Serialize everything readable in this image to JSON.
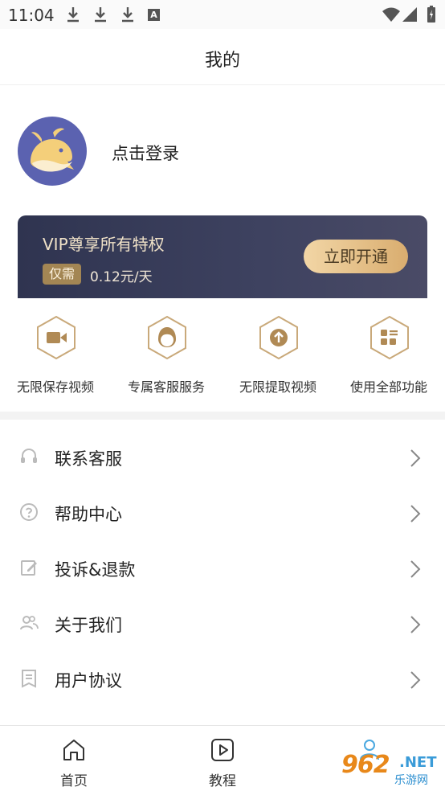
{
  "status_bar": {
    "time": "11:04"
  },
  "header": {
    "title": "我的"
  },
  "profile": {
    "login_text": "点击登录"
  },
  "vip": {
    "title": "VIP尊享所有特权",
    "badge": "仅需",
    "price": "0.12元/天",
    "button_label": "立即开通"
  },
  "features": [
    {
      "label": "无限保存视频",
      "icon": "video-camera-icon"
    },
    {
      "label": "专属客服服务",
      "icon": "customer-service-icon"
    },
    {
      "label": "无限提取视频",
      "icon": "upload-icon"
    },
    {
      "label": "使用全部功能",
      "icon": "grid-apps-icon"
    }
  ],
  "menu": [
    {
      "label": "联系客服",
      "icon": "headset-icon"
    },
    {
      "label": "帮助中心",
      "icon": "question-icon"
    },
    {
      "label": "投诉&退款",
      "icon": "edit-icon"
    },
    {
      "label": "关于我们",
      "icon": "users-icon"
    },
    {
      "label": "用户协议",
      "icon": "document-icon"
    }
  ],
  "nav": [
    {
      "label": "首页",
      "icon": "home-icon"
    },
    {
      "label": "教程",
      "icon": "play-icon"
    },
    {
      "label": "",
      "icon": "profile-icon"
    }
  ],
  "watermark": {
    "main": "962",
    "suffix": ".NET",
    "sub": "乐游网"
  },
  "colors": {
    "accent_gold": "#b8935a",
    "vip_bg": "#363a55",
    "button_gold": "#e3bf86"
  }
}
